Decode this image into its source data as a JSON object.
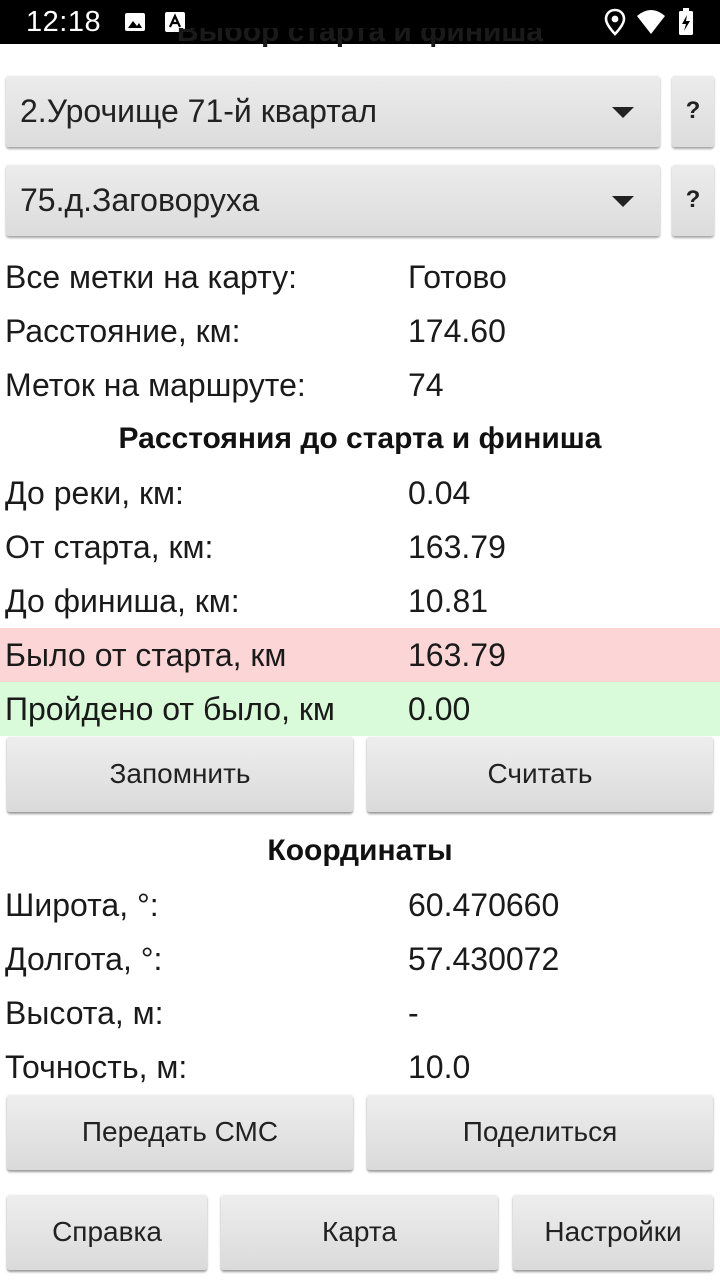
{
  "status_bar": {
    "time": "12:18",
    "icons_left": [
      "image-icon",
      "font-icon"
    ],
    "icons_right": [
      "location-icon",
      "wifi-icon",
      "battery-icon"
    ]
  },
  "selection": {
    "title": "Выбор старта и финиша",
    "start_value": "2.Урочище 71-й квартал",
    "finish_value": "75.д.Заговоруха",
    "help_label": "?"
  },
  "summary": [
    {
      "key": "Все метки на карту:",
      "value": "Готово"
    },
    {
      "key": "Расстояние, км:",
      "value": "174.60"
    },
    {
      "key": "Меток на маршруте:",
      "value": "74"
    }
  ],
  "distances": {
    "title": "Расстояния до старта и финиша",
    "rows": [
      {
        "key": "До реки, км:",
        "value": "0.04"
      },
      {
        "key": "От старта, км:",
        "value": "163.79"
      },
      {
        "key": "До финиша, км:",
        "value": "10.81"
      },
      {
        "key": "Было от старта, км",
        "value": "163.79"
      },
      {
        "key": "Пройдено от было, км",
        "value": "0.00"
      }
    ],
    "highlight_colors": {
      "was": "#fcd6d6",
      "passed": "#d9fbd9"
    },
    "remember_label": "Запомнить",
    "read_label": "Считать"
  },
  "coordinates": {
    "title": "Координаты",
    "rows": [
      {
        "key": "Широта, °:",
        "value": "60.470660"
      },
      {
        "key": "Долгота, °:",
        "value": "57.430072"
      },
      {
        "key": "Высота, м:",
        "value": "-"
      },
      {
        "key": "Точность, м:",
        "value": "10.0"
      }
    ],
    "sms_label": "Передать СМС",
    "share_label": "Поделиться"
  },
  "bottom_bar": {
    "help_label": "Справка",
    "map_label": "Карта",
    "settings_label": "Настройки"
  }
}
